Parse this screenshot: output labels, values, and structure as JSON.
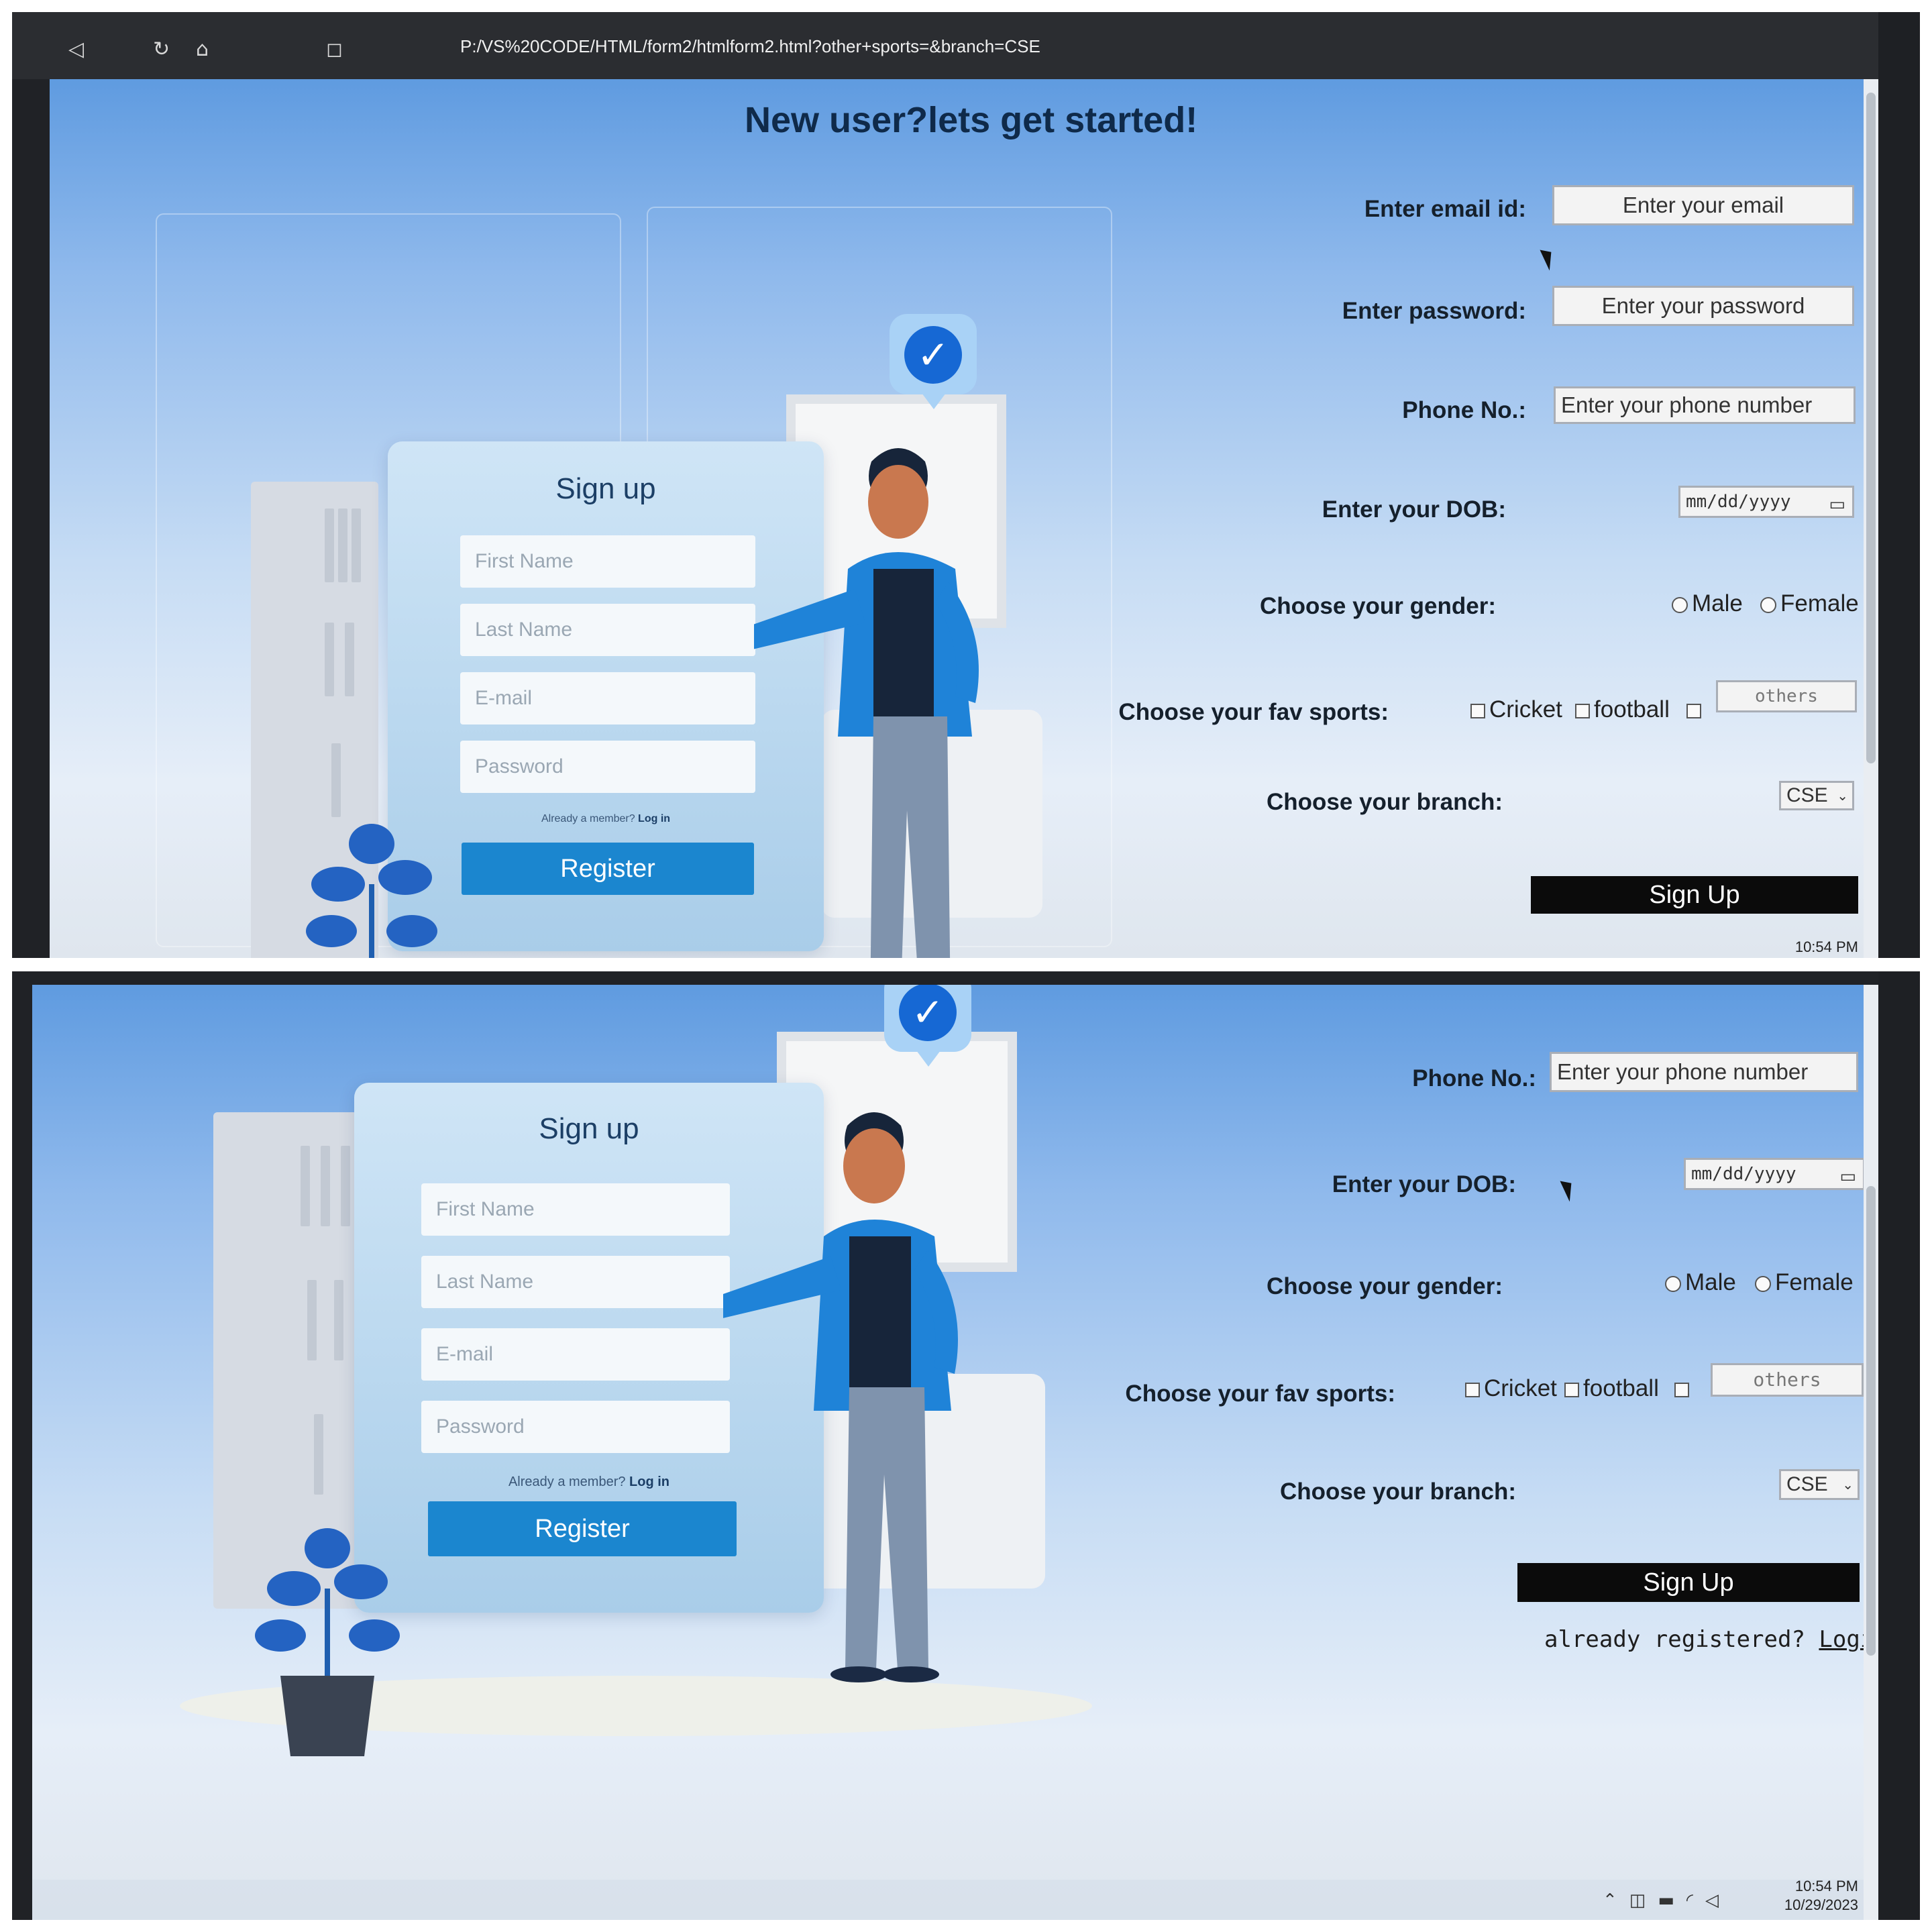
{
  "browser": {
    "url": "P:/VS%20CODE/HTML/form2/htmlform2.html?other+sports=&branch=CSE"
  },
  "heading": "New user?lets get started!",
  "illustration": {
    "title": "Sign up",
    "fields": [
      "First Name",
      "Last Name",
      "E-mail",
      "Password"
    ],
    "already": "Already a member?",
    "login": "Log in",
    "register": "Register"
  },
  "form": {
    "email_label": "Enter email id:",
    "email_placeholder": "Enter your email",
    "password_label": "Enter password:",
    "password_placeholder": "Enter your password",
    "phone_label": "Phone No.:",
    "phone_placeholder": "Enter your phone number",
    "dob_label": "Enter your DOB:",
    "dob_placeholder": "mm/dd/yyyy",
    "gender_label": "Choose your gender:",
    "gender_options": [
      "Male",
      "Female"
    ],
    "sports_label": "Choose your fav sports:",
    "sports_options": [
      "Cricket",
      "football"
    ],
    "others_placeholder": "others",
    "branch_label": "Choose your branch:",
    "branch_value": "CSE",
    "signup_label": "Sign Up",
    "already_text": "already registered?",
    "login_link": "Login"
  },
  "taskbar": {
    "time": "10:54 PM",
    "date": "10/29/2023"
  },
  "colors": {
    "register_button": "#1b86cf",
    "signup_button": "#0b0b0b",
    "check_badge": "#1668d4"
  },
  "icons": [
    "back-icon",
    "reload-icon",
    "home-icon",
    "bookmark-icon",
    "check-icon",
    "calendar-icon",
    "chevron-down-icon",
    "mouse-pointer-icon"
  ]
}
